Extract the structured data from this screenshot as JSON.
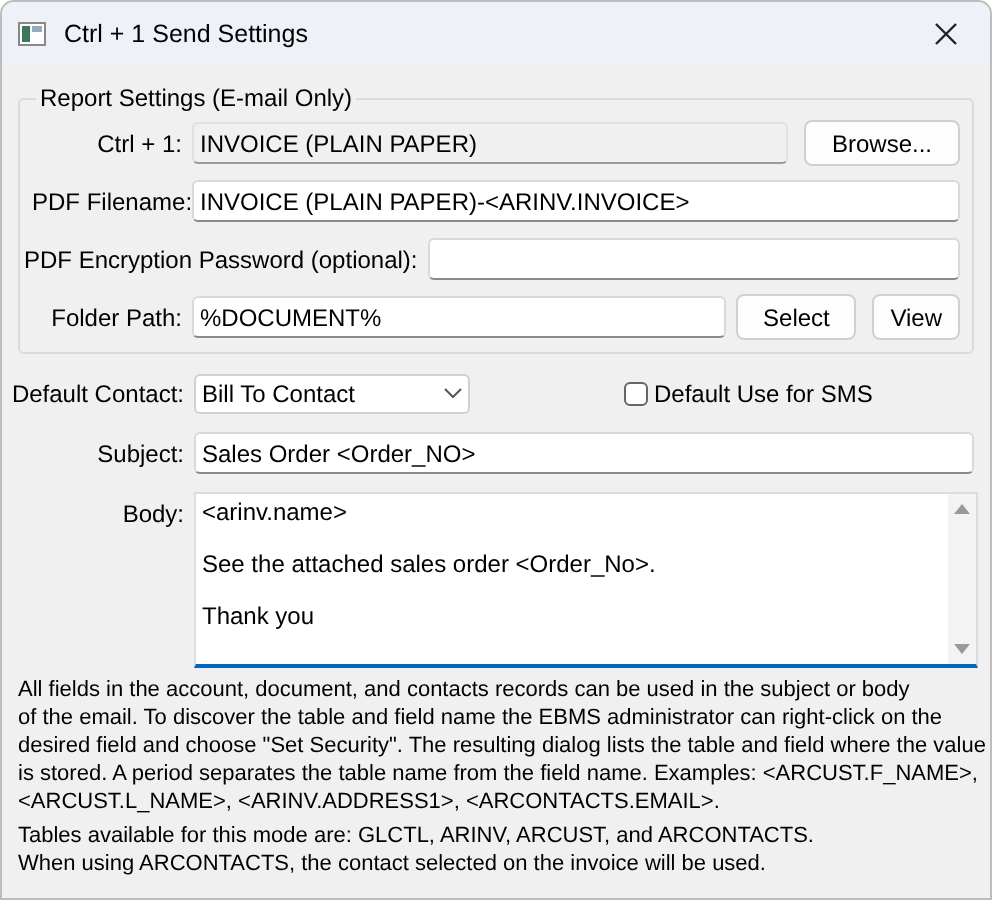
{
  "window": {
    "title": "Ctrl + 1 Send Settings"
  },
  "report_settings": {
    "title": "Report Settings (E-mail Only)",
    "ctrl_1": {
      "label": "Ctrl + 1:",
      "value": "INVOICE (PLAIN PAPER)",
      "disabled": true,
      "button": "Browse..."
    },
    "pdf_filename": {
      "label": "PDF Filename:",
      "value": "INVOICE (PLAIN PAPER)-<ARINV.INVOICE>"
    },
    "pdf_password": {
      "label": "PDF Encryption Password (optional):"
    },
    "folder_path": {
      "label": "Folder Path:",
      "value": "%DOCUMENT%",
      "buttons": [
        "Select",
        "View"
      ]
    }
  },
  "default_contact": {
    "label": "Default Contact:",
    "value": "Bill To Contact"
  },
  "sms_checkbox": {
    "label": "Default Use for SMS",
    "checked": false
  },
  "subject": {
    "label": "Subject:",
    "value": "Sales Order <Order_NO>"
  },
  "body": {
    "label": "Body:",
    "focused": true,
    "lines": [
      "<arinv.name>",
      "See the attached sales order <Order_No>.",
      "Thank you"
    ]
  },
  "help_text": [
    [
      "All fields in the account, document, and contacts records can be used in the subject or body",
      "of the email.  To discover the table and field name the EBMS administrator can right-click on the",
      "desired field and choose \"Set Security\".  The resulting dialog lists the table and field where the value",
      "is stored.  A period separates the table name from the field name. Examples: <ARCUST.F_NAME>,",
      "<ARCUST.L_NAME>, <ARINV.ADDRESS1>, <ARCONTACTS.EMAIL>."
    ],
    [
      "Tables available for this mode are: GLCTL, ARINV, ARCUST, and ARCONTACTS.",
      "When using ARCONTACTS, the contact selected on the invoice will be used."
    ]
  ]
}
